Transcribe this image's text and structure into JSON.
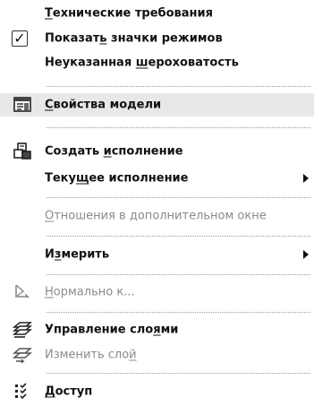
{
  "menu": {
    "items": [
      {
        "pre": "",
        "u": "Т",
        "post": "ехнические требования"
      },
      {
        "pre": "Показат",
        "u": "ь",
        "post": " значки режимов",
        "checked": "✓"
      },
      {
        "pre": "Неуказанная ",
        "u": "ш",
        "post": "ероховатость"
      },
      {
        "pre": "",
        "u": "С",
        "post": "войства модели"
      },
      {
        "pre": "Создать ",
        "u": "и",
        "post": "сполнение"
      },
      {
        "pre": "Теку",
        "u": "щ",
        "post": "ее исполнение"
      },
      {
        "pre": "",
        "u": "О",
        "post": "тношения в дополнительном окне"
      },
      {
        "pre": "И",
        "u": "з",
        "post": "мерить"
      },
      {
        "pre": "",
        "u": "Н",
        "post": "ормально к..."
      },
      {
        "pre": "Управление сло",
        "u": "я",
        "post": "ми"
      },
      {
        "pre": "Изменить сло",
        "u": "й",
        "post": ""
      },
      {
        "pre": "",
        "u": "Д",
        "post": "оступ"
      }
    ]
  },
  "icons": {
    "properties": "model-properties-icon",
    "configuration": "create-configuration-icon",
    "normal": "normal-to-icon",
    "layers": "layers-icon",
    "change_layer": "change-layer-icon",
    "access": "access-icon"
  },
  "colors": {
    "text": "#111111",
    "disabled": "#8a8a8a",
    "separator": "#9a9a9a",
    "highlight": "#e8e8e8"
  }
}
